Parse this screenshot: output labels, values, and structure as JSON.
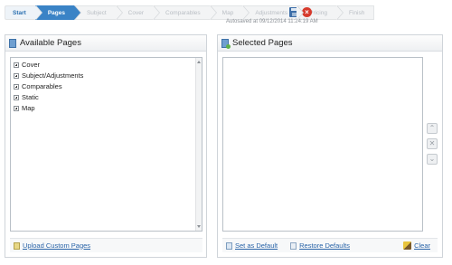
{
  "wizard": {
    "steps": [
      "Start",
      "Pages",
      "Subject",
      "Cover",
      "Comparables",
      "Map",
      "Adjustments",
      "Pricing",
      "Finish"
    ],
    "autosave": "Autosaved at 09/12/2014 11:24:19 AM"
  },
  "available": {
    "title": "Available Pages",
    "items": [
      "Cover",
      "Subject/Adjustments",
      "Comparables",
      "Static",
      "Map"
    ],
    "upload_label": "Upload Custom Pages"
  },
  "selected": {
    "title": "Selected Pages",
    "set_default_label": "Set as Default",
    "restore_label": "Restore Defaults",
    "clear_label": "Clear"
  },
  "icons": {
    "save": "save-icon",
    "cancel": "cancel-icon",
    "move_up": "chevron-up-icon",
    "remove": "remove-x-icon",
    "move_down": "chevron-down-icon"
  },
  "colors": {
    "accent": "#3a83c6",
    "link": "#2a64a8"
  }
}
